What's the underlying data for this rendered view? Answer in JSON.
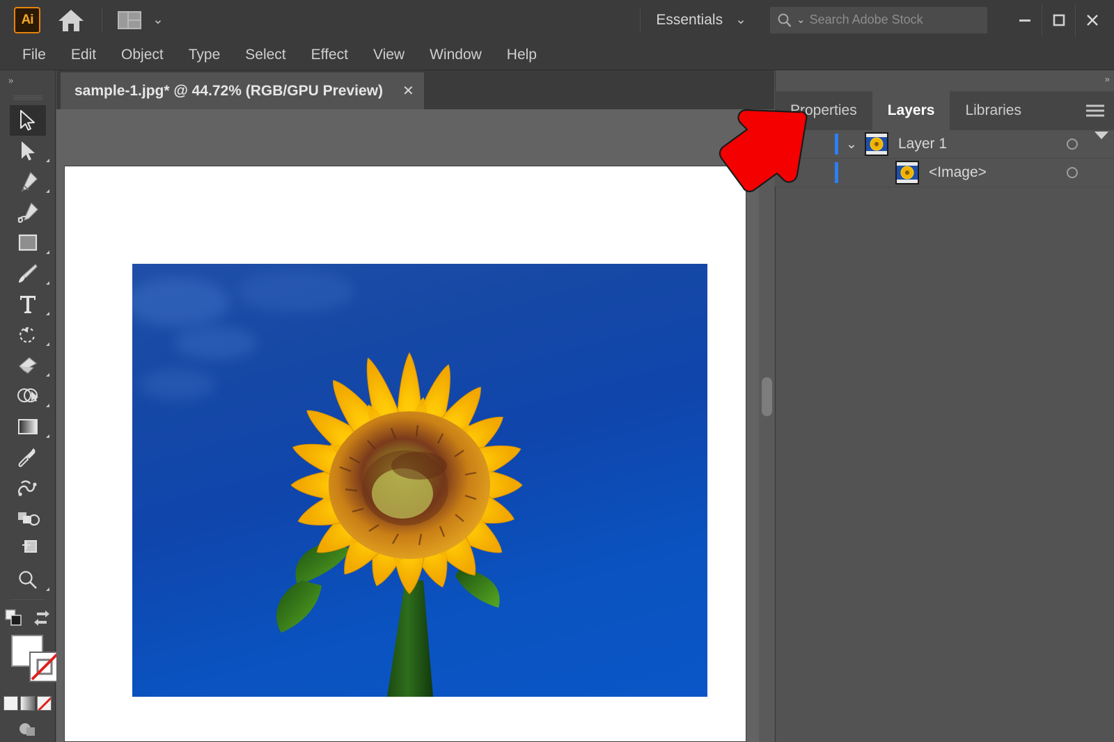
{
  "app": {
    "name": "Adobe Illustrator",
    "logo_text": "Ai",
    "home_icon": "home-icon",
    "workspace_icon": "workspace-layout-icon",
    "workspace_chevron": "⌄"
  },
  "appbar": {
    "workspace_name": "Essentials",
    "workspace_dropdown_chevron": "⌄",
    "search": {
      "placeholder": "Search Adobe Stock",
      "icon": "search-icon",
      "dropdown_chevron": "⌄",
      "value": ""
    },
    "window_controls": {
      "minimize": "—",
      "maximize": "❐",
      "close": "✕"
    }
  },
  "menubar": {
    "items": [
      {
        "label": "File"
      },
      {
        "label": "Edit"
      },
      {
        "label": "Object"
      },
      {
        "label": "Type"
      },
      {
        "label": "Select"
      },
      {
        "label": "Effect"
      },
      {
        "label": "View"
      },
      {
        "label": "Window"
      },
      {
        "label": "Help"
      }
    ]
  },
  "toolbar": {
    "collapse_label": "»",
    "tools": [
      {
        "name": "selection-tool",
        "selected": true,
        "has_flyout": false
      },
      {
        "name": "direct-selection-tool",
        "selected": false,
        "has_flyout": true
      },
      {
        "name": "pen-tool",
        "selected": false,
        "has_flyout": true
      },
      {
        "name": "curvature-tool",
        "selected": false,
        "has_flyout": false
      },
      {
        "name": "rectangle-tool",
        "selected": false,
        "has_flyout": true
      },
      {
        "name": "paintbrush-tool",
        "selected": false,
        "has_flyout": true
      },
      {
        "name": "type-tool",
        "selected": false,
        "has_flyout": true
      },
      {
        "name": "rotate-tool",
        "selected": false,
        "has_flyout": true
      },
      {
        "name": "eraser-tool",
        "selected": false,
        "has_flyout": true
      },
      {
        "name": "shape-builder-tool",
        "selected": false,
        "has_flyout": true
      },
      {
        "name": "gradient-tool",
        "selected": false,
        "has_flyout": true
      },
      {
        "name": "eyedropper-tool",
        "selected": false,
        "has_flyout": false
      },
      {
        "name": "blend-tool",
        "selected": false,
        "has_flyout": false
      },
      {
        "name": "symbol-sprayer-tool",
        "selected": false,
        "has_flyout": false
      },
      {
        "name": "artboard-tool",
        "selected": false,
        "has_flyout": false
      },
      {
        "name": "zoom-tool",
        "selected": false,
        "has_flyout": true
      }
    ],
    "fill_color": "#ffffff",
    "stroke_color": "#ffffff",
    "stroke_is_none": true,
    "swap_icon": "swap-fill-stroke-icon",
    "default_icon": "default-fill-stroke-icon",
    "mini_swatches": [
      "color-swatch",
      "gradient-swatch",
      "none-swatch"
    ],
    "screen_mode_icon": "screen-mode-icon"
  },
  "document": {
    "tab_title": "sample-1.jpg* @ 44.72% (RGB/GPU Preview)",
    "filename": "sample-1.jpg",
    "modified": true,
    "zoom": "44.72%",
    "color_mode": "RGB",
    "preview_mode": "GPU Preview",
    "close_label": "✕"
  },
  "canvas": {
    "artboard_background": "#ffffff",
    "image_alt": "sunflower-on-blue-sky",
    "scrollbar": "vertical-scrollbar"
  },
  "right_panel": {
    "expand_label": "»",
    "menu_icon": "panel-menu-icon",
    "tabs": [
      {
        "label": "Properties",
        "active": false
      },
      {
        "label": "Layers",
        "active": true
      },
      {
        "label": "Libraries",
        "active": false
      }
    ],
    "layers": [
      {
        "name": "Layer 1",
        "visible": true,
        "locked": false,
        "selected": true,
        "expanded": true,
        "indent": 0,
        "disclosure": "⌄",
        "thumbnail": "sunflower-thumbnail",
        "target_icon": "target-circle-icon"
      },
      {
        "name": "<Image>",
        "visible": true,
        "locked": false,
        "selected": true,
        "expanded": false,
        "indent": 1,
        "disclosure": "",
        "thumbnail": "sunflower-thumbnail",
        "target_icon": "target-circle-icon"
      }
    ]
  },
  "annotation": {
    "type": "arrow",
    "color": "#f40000",
    "direction": "up-right",
    "points_to": "layers-panel-tabs"
  },
  "colors": {
    "app_chrome": "#3b3b3b",
    "panel_bg": "#535353",
    "toolbar_bg": "#454545",
    "canvas_bg": "#636363",
    "accent_blue": "#2d7ff2",
    "brand_orange": "#e8820c",
    "annotation_red": "#f40000"
  }
}
